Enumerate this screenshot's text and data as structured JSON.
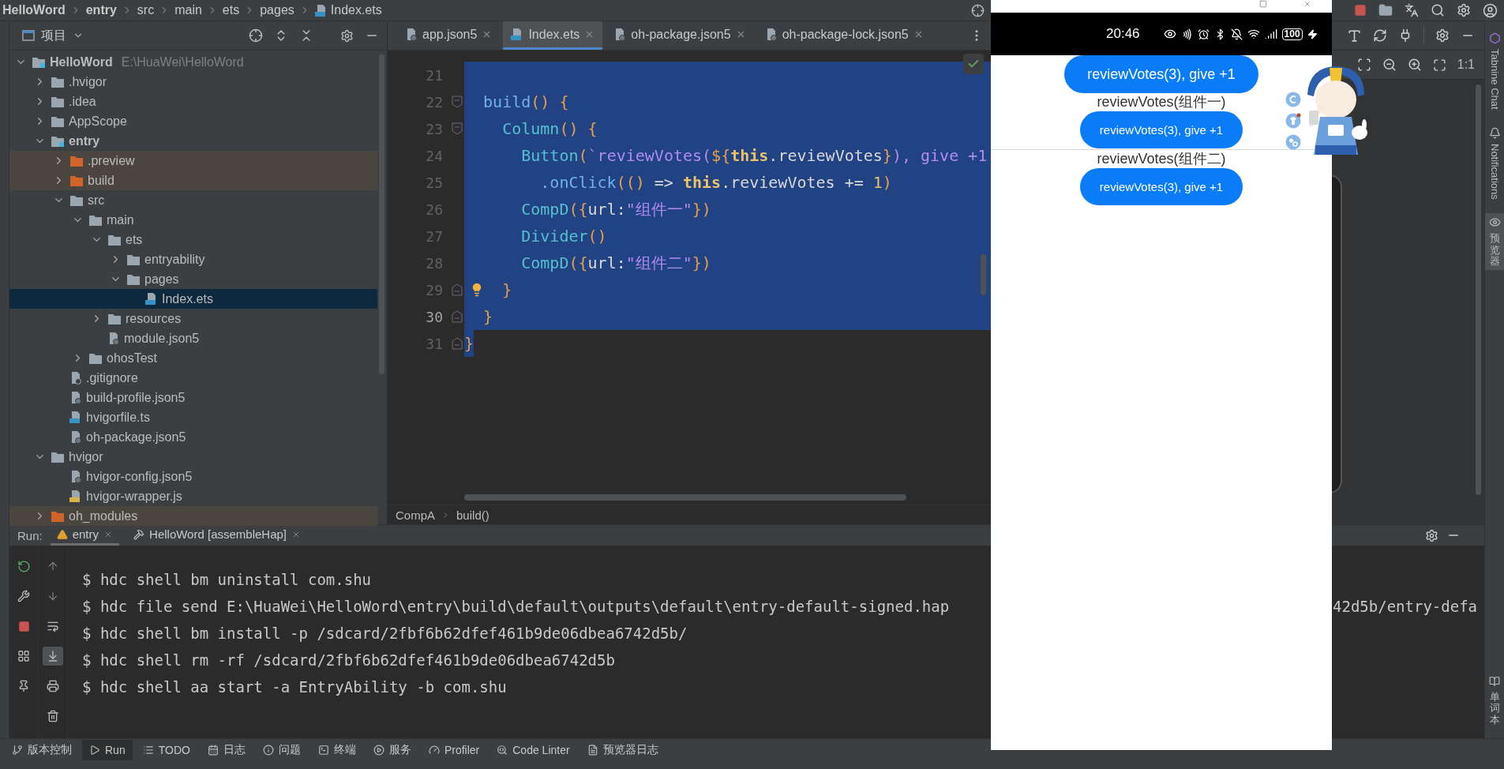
{
  "breadcrumb": [
    {
      "label": "HelloWord",
      "kind": "project"
    },
    {
      "label": "entry",
      "kind": "module"
    },
    {
      "label": "src",
      "kind": "folder"
    },
    {
      "label": "main",
      "kind": "folder"
    },
    {
      "label": "ets",
      "kind": "folder"
    },
    {
      "label": "pages",
      "kind": "folder"
    },
    {
      "label": "Index.ets",
      "kind": "ets"
    }
  ],
  "project_panel": {
    "title": "项目",
    "tree": [
      {
        "label": "HelloWord",
        "kind": "project",
        "note": "E:\\HuaWei\\HelloWord",
        "expanded": true,
        "selected": false,
        "children": [
          {
            "label": ".hvigor",
            "kind": "folder",
            "expanded": false,
            "selected": false
          },
          {
            "label": ".idea",
            "kind": "folder",
            "expanded": false,
            "selected": false
          },
          {
            "label": "AppScope",
            "kind": "folder",
            "expanded": false,
            "selected": false
          },
          {
            "label": "entry",
            "kind": "module",
            "expanded": true,
            "selected": false,
            "children": [
              {
                "label": ".preview",
                "kind": "excluded",
                "expanded": false,
                "selected": false
              },
              {
                "label": "build",
                "kind": "excluded",
                "expanded": false,
                "selected": false
              },
              {
                "label": "src",
                "kind": "folder",
                "expanded": true,
                "selected": false,
                "children": [
                  {
                    "label": "main",
                    "kind": "folder",
                    "expanded": true,
                    "selected": false,
                    "children": [
                      {
                        "label": "ets",
                        "kind": "folder",
                        "expanded": true,
                        "selected": false,
                        "children": [
                          {
                            "label": "entryability",
                            "kind": "folder",
                            "expanded": false,
                            "selected": false
                          },
                          {
                            "label": "pages",
                            "kind": "folder",
                            "expanded": true,
                            "selected": false,
                            "children": [
                              {
                                "label": "Index.ets",
                                "kind": "ets",
                                "selected": true
                              }
                            ]
                          }
                        ]
                      },
                      {
                        "label": "resources",
                        "kind": "folder",
                        "expanded": false,
                        "selected": false
                      },
                      {
                        "label": "module.json5",
                        "kind": "json",
                        "selected": false
                      }
                    ]
                  },
                  {
                    "label": "ohosTest",
                    "kind": "folder",
                    "expanded": false,
                    "selected": false
                  }
                ]
              },
              {
                "label": ".gitignore",
                "kind": "ignore",
                "selected": false
              },
              {
                "label": "build-profile.json5",
                "kind": "json",
                "selected": false
              },
              {
                "label": "hvigorfile.ts",
                "kind": "ts",
                "selected": false
              },
              {
                "label": "oh-package.json5",
                "kind": "json",
                "selected": false
              }
            ]
          },
          {
            "label": "hvigor",
            "kind": "folder",
            "expanded": true,
            "selected": false,
            "children": [
              {
                "label": "hvigor-config.json5",
                "kind": "json",
                "selected": false
              },
              {
                "label": "hvigor-wrapper.js",
                "kind": "js",
                "selected": false
              }
            ]
          },
          {
            "label": "oh_modules",
            "kind": "excluded",
            "expanded": false,
            "selected": false
          }
        ]
      }
    ]
  },
  "editor": {
    "tabs": [
      {
        "label": "app.json5",
        "kind": "json",
        "selected": false
      },
      {
        "label": "Index.ets",
        "kind": "ets",
        "selected": true
      },
      {
        "label": "oh-package.json5",
        "kind": "json",
        "selected": false
      },
      {
        "label": "oh-package-lock.json5",
        "kind": "json",
        "selected": false
      }
    ],
    "lines": [
      {
        "number": "21",
        "current": false,
        "selected": true,
        "fold_start": false,
        "fold_end": false,
        "bulb": false
      },
      {
        "number": "22",
        "current": false,
        "selected": true,
        "fold_start": true,
        "fold_end": false,
        "bulb": false,
        "tokens": [
          {
            "t": "  build",
            "kind": "method"
          },
          {
            "t": "() {",
            "kind": "punct"
          }
        ]
      },
      {
        "number": "23",
        "current": false,
        "selected": true,
        "fold_start": true,
        "fold_end": false,
        "bulb": false,
        "tokens": [
          {
            "t": "    Column",
            "kind": "comp"
          },
          {
            "t": "() {",
            "kind": "punct"
          }
        ]
      },
      {
        "number": "24",
        "current": false,
        "selected": true,
        "fold_start": false,
        "fold_end": false,
        "bulb": false,
        "tokens": [
          {
            "t": "      Button",
            "kind": "comp"
          },
          {
            "t": "(",
            "kind": "punct"
          },
          {
            "t": "`reviewVotes(",
            "kind": "str"
          },
          {
            "t": "${",
            "kind": "punct"
          },
          {
            "t": "this",
            "kind": "kw"
          },
          {
            "t": ".reviewVotes",
            "kind": "plain"
          },
          {
            "t": "}",
            "kind": "punct"
          },
          {
            "t": "), give +1",
            "kind": "str"
          }
        ]
      },
      {
        "number": "25",
        "current": false,
        "selected": true,
        "fold_start": false,
        "fold_end": false,
        "bulb": false,
        "tokens": [
          {
            "t": "        .onClick",
            "kind": "method"
          },
          {
            "t": "(()",
            "kind": "punct"
          },
          {
            "t": " => ",
            "kind": "plain"
          },
          {
            "t": "this",
            "kind": "kw"
          },
          {
            "t": ".reviewVotes += ",
            "kind": "plain"
          },
          {
            "t": "1",
            "kind": "num"
          },
          {
            "t": ")",
            "kind": "punct"
          }
        ]
      },
      {
        "number": "26",
        "current": false,
        "selected": true,
        "fold_start": false,
        "fold_end": false,
        "bulb": false,
        "tokens": [
          {
            "t": "      CompD",
            "kind": "comp"
          },
          {
            "t": "({",
            "kind": "punct"
          },
          {
            "t": "url:",
            "kind": "plain"
          },
          {
            "t": "\"组件一\"",
            "kind": "str"
          },
          {
            "t": "})",
            "kind": "punct"
          }
        ]
      },
      {
        "number": "27",
        "current": false,
        "selected": true,
        "fold_start": false,
        "fold_end": false,
        "bulb": false,
        "tokens": [
          {
            "t": "      Divider",
            "kind": "comp"
          },
          {
            "t": "()",
            "kind": "punct"
          }
        ]
      },
      {
        "number": "28",
        "current": false,
        "selected": true,
        "fold_start": false,
        "fold_end": false,
        "bulb": false,
        "tokens": [
          {
            "t": "      CompD",
            "kind": "comp"
          },
          {
            "t": "({",
            "kind": "punct"
          },
          {
            "t": "url:",
            "kind": "plain"
          },
          {
            "t": "\"组件二\"",
            "kind": "str"
          },
          {
            "t": "})",
            "kind": "punct"
          }
        ]
      },
      {
        "number": "29",
        "current": false,
        "selected": true,
        "fold_start": false,
        "fold_end": true,
        "bulb": true,
        "tokens": [
          {
            "t": "    }",
            "kind": "punct"
          }
        ]
      },
      {
        "number": "30",
        "current": true,
        "selected": true,
        "fold_start": false,
        "fold_end": true,
        "bulb": false,
        "tokens": [
          {
            "t": "  }",
            "kind": "punct"
          }
        ]
      },
      {
        "number": "31",
        "current": false,
        "selected": false,
        "fold_start": false,
        "fold_end": true,
        "bulb": false,
        "tokens": [
          {
            "t": "}",
            "kind": "punct",
            "selected": true
          }
        ]
      }
    ],
    "footer": [
      "CompA",
      "build()"
    ]
  },
  "emulator": {
    "time": "20:46",
    "battery": "100",
    "button": "reviewVotes(3), give +1",
    "components": [
      {
        "label": "reviewVotes(组件一)",
        "button": "reviewVotes(3), give +1"
      },
      {
        "label": "reviewVotes(组件二)",
        "button": "reviewVotes(3), give +1"
      }
    ]
  },
  "preview_panel": {
    "zoom_label": "1:1"
  },
  "right_strip": {
    "top": [
      {
        "label": "Tabnine Chat",
        "selected": false
      },
      {
        "label": "Notifications",
        "selected": false
      },
      {
        "label": "预览器",
        "selected": true
      }
    ],
    "bottom": [
      {
        "label": "单词本",
        "selected": false
      }
    ]
  },
  "run_panel": {
    "title": "Run:",
    "tabs": [
      {
        "label": "entry",
        "selected": true
      },
      {
        "label": "HelloWord [assembleHap]",
        "selected": false
      }
    ],
    "lines": [
      {
        "text": "$ hdc shell bm uninstall com.shu"
      },
      {
        "text": "$ hdc file send E:\\HuaWei\\HelloWord\\entry\\build\\default\\outputs\\default\\entry-default-signed.hap",
        "tail": "42d5b/entry-defa"
      },
      {
        "text": "$ hdc shell bm install -p /sdcard/2fbf6b62dfef461b9de06dbea6742d5b/"
      },
      {
        "text": "$ hdc shell rm -rf /sdcard/2fbf6b62dfef461b9de06dbea6742d5b"
      },
      {
        "text": "$ hdc shell aa start -a EntryAbility -b com.shu"
      }
    ]
  },
  "tool_windows": [
    {
      "label": "版本控制",
      "selected": false
    },
    {
      "label": "Run",
      "selected": true
    },
    {
      "label": "TODO",
      "selected": false
    },
    {
      "label": "日志",
      "selected": false
    },
    {
      "label": "问题",
      "selected": false
    },
    {
      "label": "终端",
      "selected": false
    },
    {
      "label": "服务",
      "selected": false
    },
    {
      "label": "Profiler",
      "selected": false
    },
    {
      "label": "Code Linter",
      "selected": false
    },
    {
      "label": "预览器日志",
      "selected": false
    }
  ]
}
